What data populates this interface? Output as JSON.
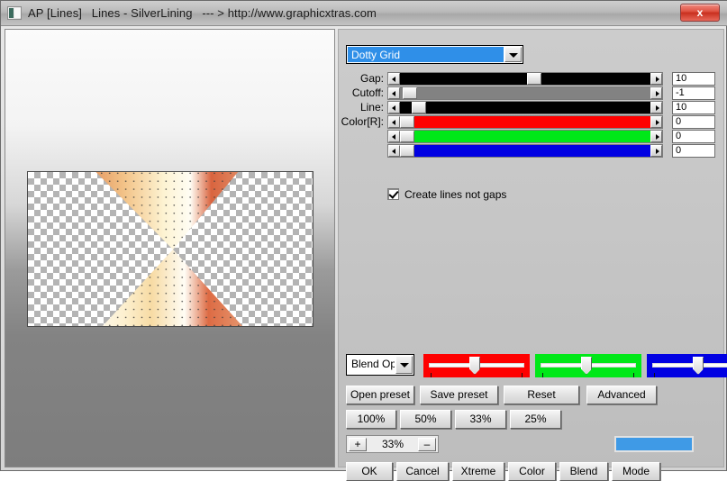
{
  "window": {
    "title_segments": [
      "AP [Lines]",
      "Lines - SilverLining",
      "--- > http://www.graphicxtras.com"
    ],
    "close_label": "x",
    "app_icon": "document-icon"
  },
  "preview": {
    "name": "image-preview-canvas",
    "description": "bowtie hourglass gradient with dot grid over transparency checkerboard"
  },
  "panel": {
    "preset_combo": {
      "value": "Dotty Grid",
      "options": [
        "Dotty Grid"
      ]
    },
    "sliders": [
      {
        "label": "Gap:",
        "value": "10",
        "thumb_pct": 54,
        "track_color": "#000000"
      },
      {
        "label": "Cutoff:",
        "value": "-1",
        "thumb_pct": 1,
        "track_color": "#828282"
      },
      {
        "label": "Line:",
        "value": "10",
        "thumb_pct": 5,
        "track_color": "#000000"
      },
      {
        "label": "Color[R]:",
        "value": "0",
        "thumb_pct": 0,
        "track_color": "#fe0000"
      },
      {
        "label": "",
        "value": "0",
        "thumb_pct": 0,
        "track_color": "#00e818"
      },
      {
        "label": "",
        "value": "0",
        "thumb_pct": 0,
        "track_color": "#0000e2"
      }
    ],
    "checkbox": {
      "label": "Create lines not gaps",
      "checked": true
    },
    "blend_combo": {
      "value": "Blend Opti"
    },
    "rgb_sliders": [
      {
        "name": "red",
        "color": "#fe0000",
        "knob_pct": 48
      },
      {
        "name": "green",
        "color": "#00e818",
        "knob_pct": 48
      },
      {
        "name": "blue",
        "color": "#0000e2",
        "knob_pct": 48
      }
    ],
    "preset_buttons": [
      "Open preset",
      "Save preset",
      "Reset",
      "Advanced"
    ],
    "zoom_buttons": [
      "100%",
      "50%",
      "33%",
      "25%"
    ],
    "stepper": {
      "plus": "+",
      "value": "33%",
      "minus": "–"
    },
    "color_swatch": "#3f9ae6",
    "action_buttons": [
      "OK",
      "Cancel",
      "Xtreme",
      "Color",
      "Blend",
      "Mode"
    ]
  }
}
